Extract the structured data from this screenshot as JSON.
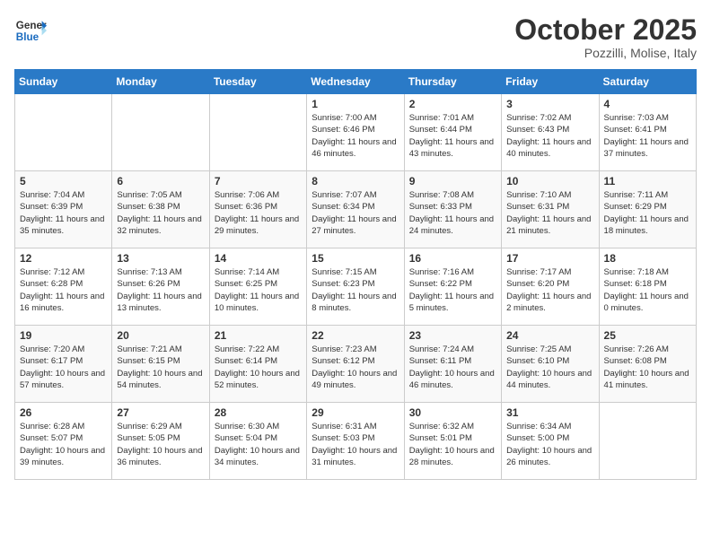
{
  "header": {
    "logo_general": "General",
    "logo_blue": "Blue",
    "month_title": "October 2025",
    "location": "Pozzilli, Molise, Italy"
  },
  "days_of_week": [
    "Sunday",
    "Monday",
    "Tuesday",
    "Wednesday",
    "Thursday",
    "Friday",
    "Saturday"
  ],
  "weeks": [
    {
      "days": [
        {
          "num": "",
          "info": ""
        },
        {
          "num": "",
          "info": ""
        },
        {
          "num": "",
          "info": ""
        },
        {
          "num": "1",
          "info": "Sunrise: 7:00 AM\nSunset: 6:46 PM\nDaylight: 11 hours and 46 minutes."
        },
        {
          "num": "2",
          "info": "Sunrise: 7:01 AM\nSunset: 6:44 PM\nDaylight: 11 hours and 43 minutes."
        },
        {
          "num": "3",
          "info": "Sunrise: 7:02 AM\nSunset: 6:43 PM\nDaylight: 11 hours and 40 minutes."
        },
        {
          "num": "4",
          "info": "Sunrise: 7:03 AM\nSunset: 6:41 PM\nDaylight: 11 hours and 37 minutes."
        }
      ]
    },
    {
      "days": [
        {
          "num": "5",
          "info": "Sunrise: 7:04 AM\nSunset: 6:39 PM\nDaylight: 11 hours and 35 minutes."
        },
        {
          "num": "6",
          "info": "Sunrise: 7:05 AM\nSunset: 6:38 PM\nDaylight: 11 hours and 32 minutes."
        },
        {
          "num": "7",
          "info": "Sunrise: 7:06 AM\nSunset: 6:36 PM\nDaylight: 11 hours and 29 minutes."
        },
        {
          "num": "8",
          "info": "Sunrise: 7:07 AM\nSunset: 6:34 PM\nDaylight: 11 hours and 27 minutes."
        },
        {
          "num": "9",
          "info": "Sunrise: 7:08 AM\nSunset: 6:33 PM\nDaylight: 11 hours and 24 minutes."
        },
        {
          "num": "10",
          "info": "Sunrise: 7:10 AM\nSunset: 6:31 PM\nDaylight: 11 hours and 21 minutes."
        },
        {
          "num": "11",
          "info": "Sunrise: 7:11 AM\nSunset: 6:29 PM\nDaylight: 11 hours and 18 minutes."
        }
      ]
    },
    {
      "days": [
        {
          "num": "12",
          "info": "Sunrise: 7:12 AM\nSunset: 6:28 PM\nDaylight: 11 hours and 16 minutes."
        },
        {
          "num": "13",
          "info": "Sunrise: 7:13 AM\nSunset: 6:26 PM\nDaylight: 11 hours and 13 minutes."
        },
        {
          "num": "14",
          "info": "Sunrise: 7:14 AM\nSunset: 6:25 PM\nDaylight: 11 hours and 10 minutes."
        },
        {
          "num": "15",
          "info": "Sunrise: 7:15 AM\nSunset: 6:23 PM\nDaylight: 11 hours and 8 minutes."
        },
        {
          "num": "16",
          "info": "Sunrise: 7:16 AM\nSunset: 6:22 PM\nDaylight: 11 hours and 5 minutes."
        },
        {
          "num": "17",
          "info": "Sunrise: 7:17 AM\nSunset: 6:20 PM\nDaylight: 11 hours and 2 minutes."
        },
        {
          "num": "18",
          "info": "Sunrise: 7:18 AM\nSunset: 6:18 PM\nDaylight: 11 hours and 0 minutes."
        }
      ]
    },
    {
      "days": [
        {
          "num": "19",
          "info": "Sunrise: 7:20 AM\nSunset: 6:17 PM\nDaylight: 10 hours and 57 minutes."
        },
        {
          "num": "20",
          "info": "Sunrise: 7:21 AM\nSunset: 6:15 PM\nDaylight: 10 hours and 54 minutes."
        },
        {
          "num": "21",
          "info": "Sunrise: 7:22 AM\nSunset: 6:14 PM\nDaylight: 10 hours and 52 minutes."
        },
        {
          "num": "22",
          "info": "Sunrise: 7:23 AM\nSunset: 6:12 PM\nDaylight: 10 hours and 49 minutes."
        },
        {
          "num": "23",
          "info": "Sunrise: 7:24 AM\nSunset: 6:11 PM\nDaylight: 10 hours and 46 minutes."
        },
        {
          "num": "24",
          "info": "Sunrise: 7:25 AM\nSunset: 6:10 PM\nDaylight: 10 hours and 44 minutes."
        },
        {
          "num": "25",
          "info": "Sunrise: 7:26 AM\nSunset: 6:08 PM\nDaylight: 10 hours and 41 minutes."
        }
      ]
    },
    {
      "days": [
        {
          "num": "26",
          "info": "Sunrise: 6:28 AM\nSunset: 5:07 PM\nDaylight: 10 hours and 39 minutes."
        },
        {
          "num": "27",
          "info": "Sunrise: 6:29 AM\nSunset: 5:05 PM\nDaylight: 10 hours and 36 minutes."
        },
        {
          "num": "28",
          "info": "Sunrise: 6:30 AM\nSunset: 5:04 PM\nDaylight: 10 hours and 34 minutes."
        },
        {
          "num": "29",
          "info": "Sunrise: 6:31 AM\nSunset: 5:03 PM\nDaylight: 10 hours and 31 minutes."
        },
        {
          "num": "30",
          "info": "Sunrise: 6:32 AM\nSunset: 5:01 PM\nDaylight: 10 hours and 28 minutes."
        },
        {
          "num": "31",
          "info": "Sunrise: 6:34 AM\nSunset: 5:00 PM\nDaylight: 10 hours and 26 minutes."
        },
        {
          "num": "",
          "info": ""
        }
      ]
    }
  ]
}
